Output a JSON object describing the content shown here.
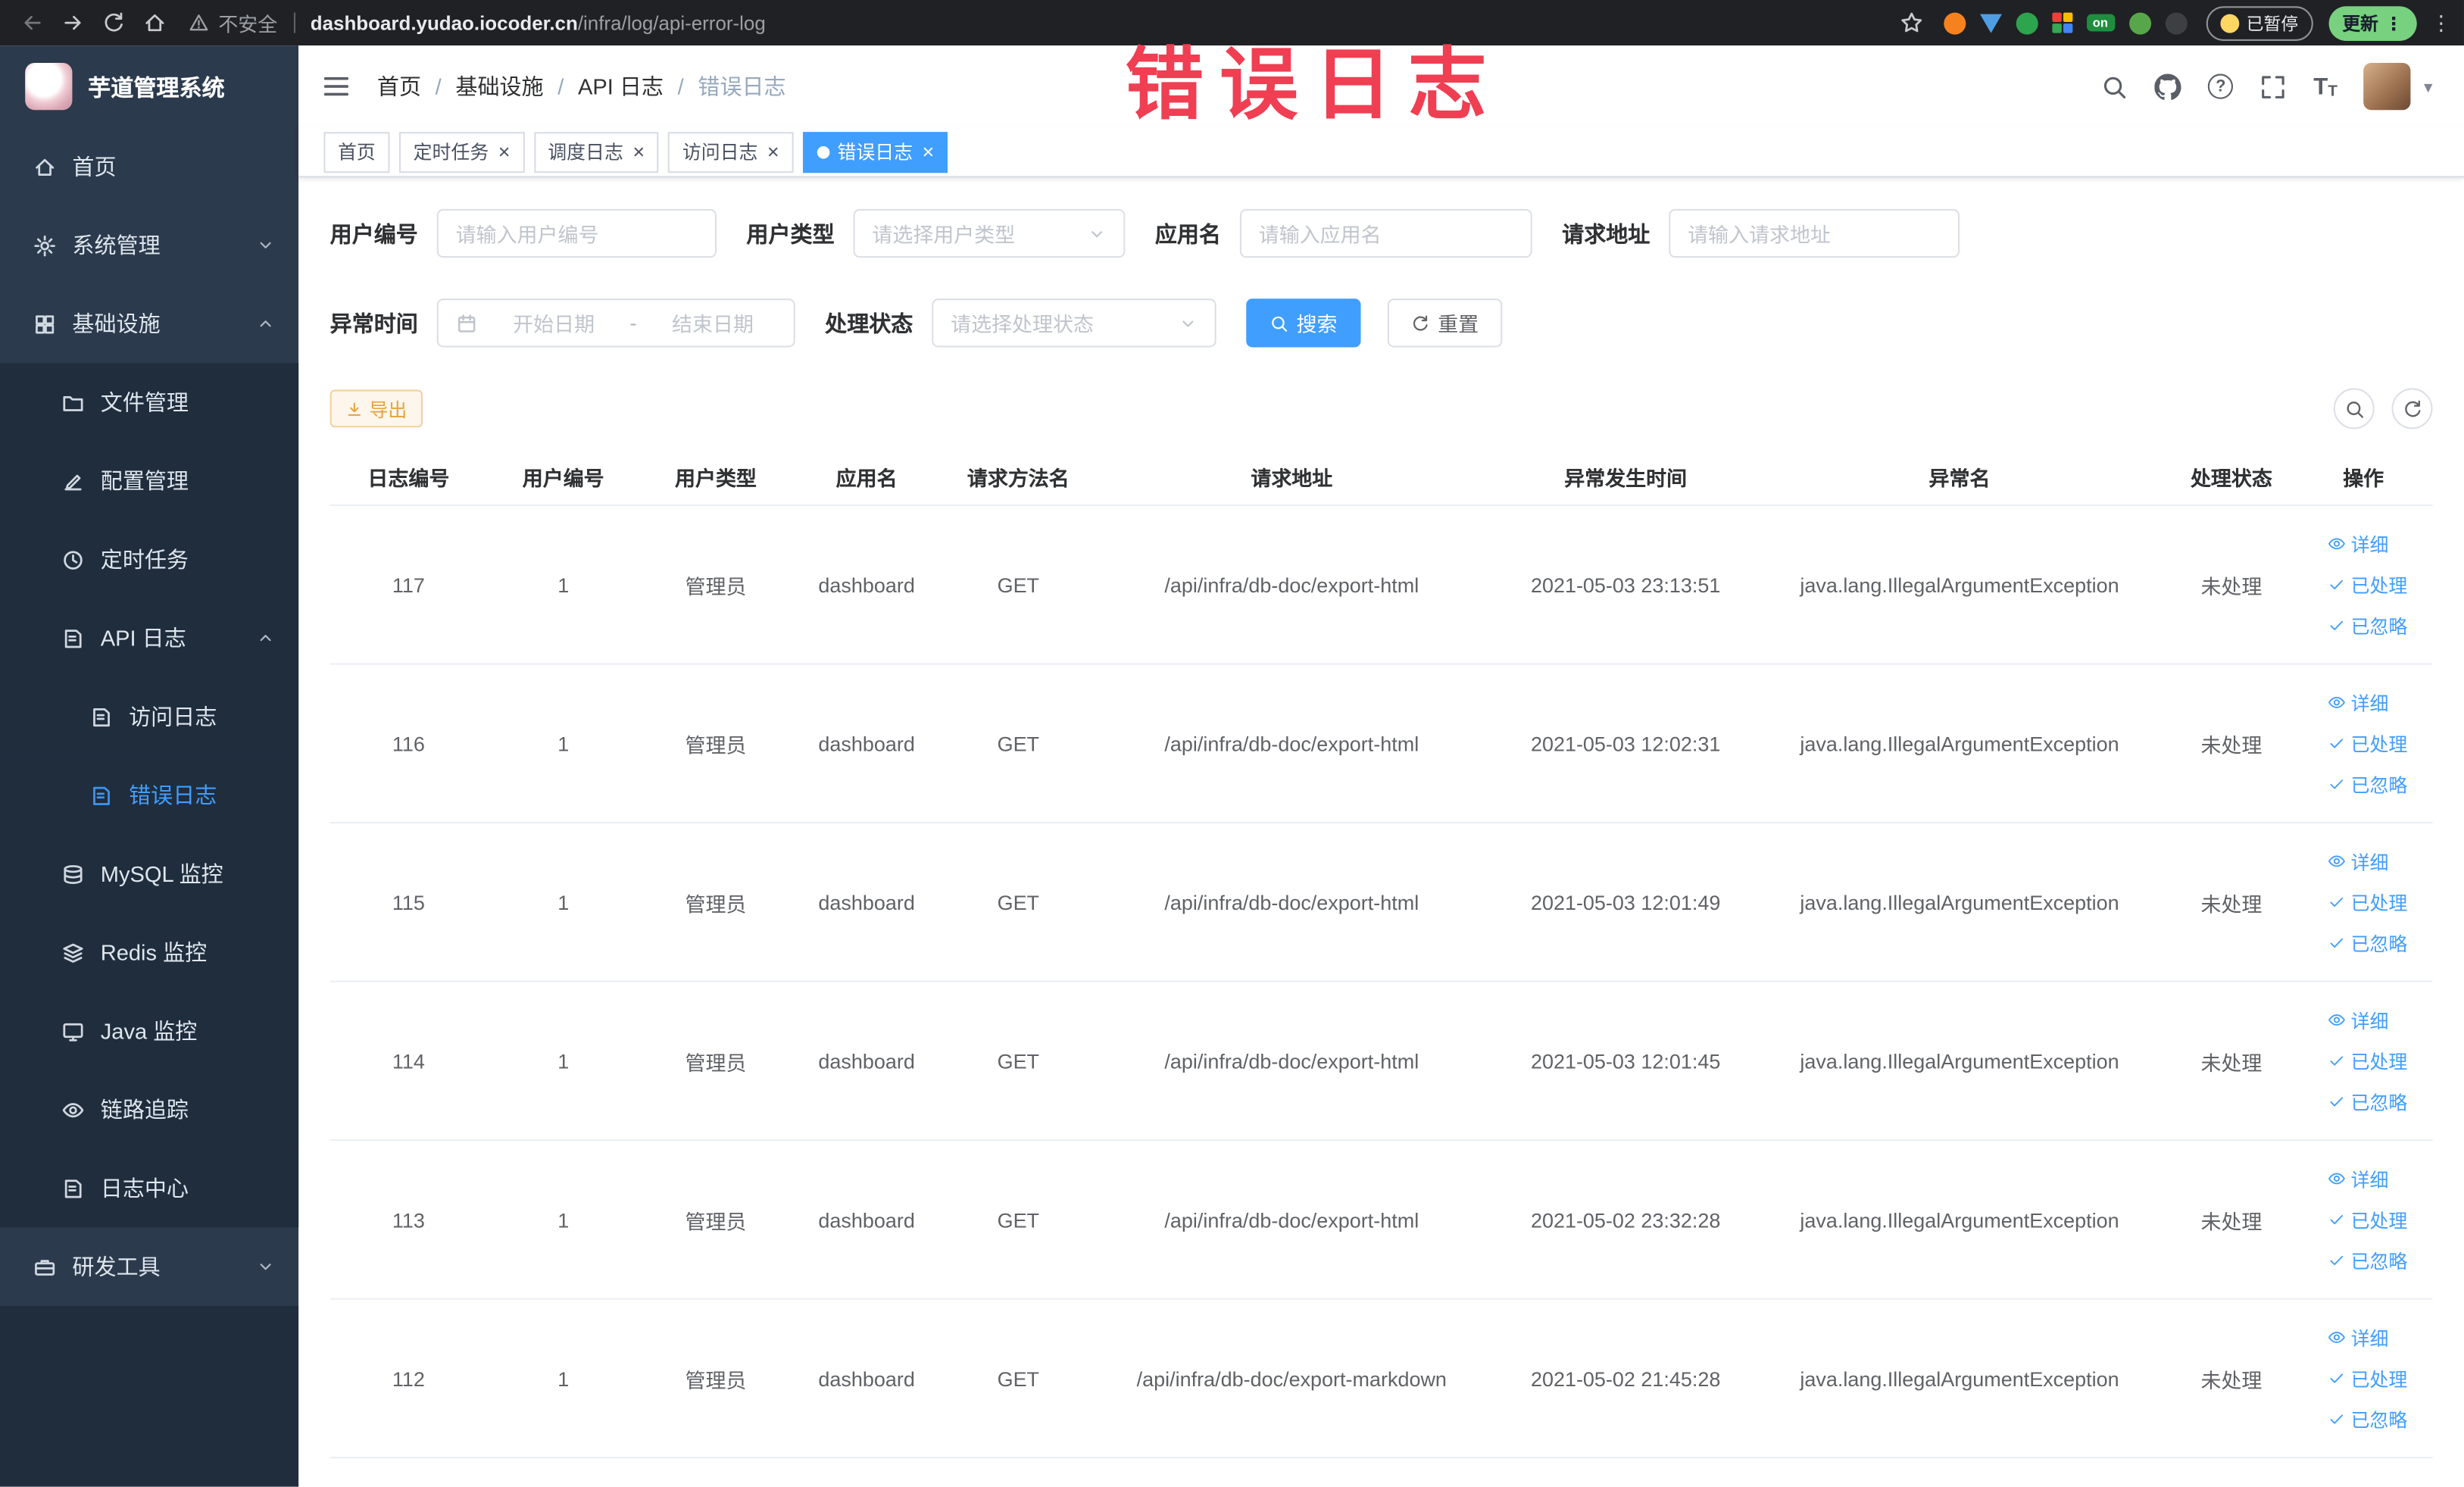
{
  "browser": {
    "security_label": "不安全",
    "url_domain": "dashboard.yudao.iocoder.cn",
    "url_path": "/infra/log/api-error-log",
    "paused_badge": "已暂停",
    "update_button": "更新"
  },
  "annotation": "错误日志",
  "sidebar": {
    "logo_title": "芋道管理系统",
    "items": [
      {
        "key": "home",
        "label": "首页",
        "icon": "home",
        "level": 1
      },
      {
        "key": "system",
        "label": "系统管理",
        "icon": "gear",
        "level": 1,
        "arrow": "down"
      },
      {
        "key": "infra",
        "label": "基础设施",
        "icon": "grid",
        "level": 1,
        "arrow": "up"
      },
      {
        "key": "file",
        "label": "文件管理",
        "icon": "folder",
        "level": 2
      },
      {
        "key": "config",
        "label": "配置管理",
        "icon": "edit",
        "level": 2
      },
      {
        "key": "job",
        "label": "定时任务",
        "icon": "clock",
        "level": 2
      },
      {
        "key": "api-log",
        "label": "API 日志",
        "icon": "doc",
        "level": 2,
        "arrow": "up"
      },
      {
        "key": "access-log",
        "label": "访问日志",
        "icon": "doc",
        "level": 3
      },
      {
        "key": "error-log",
        "label": "错误日志",
        "icon": "doc",
        "level": 3,
        "active": true
      },
      {
        "key": "mysql",
        "label": "MySQL 监控",
        "icon": "db",
        "level": 2
      },
      {
        "key": "redis",
        "label": "Redis 监控",
        "icon": "layers",
        "level": 2
      },
      {
        "key": "java",
        "label": "Java 监控",
        "icon": "monitor",
        "level": 2
      },
      {
        "key": "trace",
        "label": "链路追踪",
        "icon": "eye",
        "level": 2
      },
      {
        "key": "log-center",
        "label": "日志中心",
        "icon": "doc",
        "level": 2
      },
      {
        "key": "dev-tools",
        "label": "研发工具",
        "icon": "tools",
        "level": 1,
        "arrow": "down"
      }
    ]
  },
  "breadcrumb": [
    "首页",
    "基础设施",
    "API 日志",
    "错误日志"
  ],
  "tabs": [
    {
      "label": "首页",
      "closable": false,
      "active": false
    },
    {
      "label": "定时任务",
      "closable": true,
      "active": false
    },
    {
      "label": "调度日志",
      "closable": true,
      "active": false
    },
    {
      "label": "访问日志",
      "closable": true,
      "active": false
    },
    {
      "label": "错误日志",
      "closable": true,
      "active": true
    }
  ],
  "filters": {
    "user_id_label": "用户编号",
    "user_id_placeholder": "请输入用户编号",
    "user_type_label": "用户类型",
    "user_type_placeholder": "请选择用户类型",
    "app_name_label": "应用名",
    "app_name_placeholder": "请输入应用名",
    "request_url_label": "请求地址",
    "request_url_placeholder": "请输入请求地址",
    "exception_time_label": "异常时间",
    "date_start_placeholder": "开始日期",
    "date_end_placeholder": "结束日期",
    "process_status_label": "处理状态",
    "process_status_placeholder": "请选择处理状态",
    "search_button": "搜索",
    "reset_button": "重置"
  },
  "toolbar": {
    "export_button": "导出"
  },
  "table": {
    "columns": [
      "日志编号",
      "用户编号",
      "用户类型",
      "应用名",
      "请求方法名",
      "请求地址",
      "异常发生时间",
      "异常名",
      "处理状态",
      "操作"
    ],
    "actions": {
      "detail": "详细",
      "processed": "已处理",
      "ignored": "已忽略"
    },
    "rows": [
      {
        "id": "117",
        "user_id": "1",
        "user_type": "管理员",
        "app": "dashboard",
        "method": "GET",
        "url": "/api/infra/db-doc/export-html",
        "time": "2021-05-03 23:13:51",
        "exception": "java.lang.IllegalArgumentException",
        "status": "未处理"
      },
      {
        "id": "116",
        "user_id": "1",
        "user_type": "管理员",
        "app": "dashboard",
        "method": "GET",
        "url": "/api/infra/db-doc/export-html",
        "time": "2021-05-03 12:02:31",
        "exception": "java.lang.IllegalArgumentException",
        "status": "未处理"
      },
      {
        "id": "115",
        "user_id": "1",
        "user_type": "管理员",
        "app": "dashboard",
        "method": "GET",
        "url": "/api/infra/db-doc/export-html",
        "time": "2021-05-03 12:01:49",
        "exception": "java.lang.IllegalArgumentException",
        "status": "未处理"
      },
      {
        "id": "114",
        "user_id": "1",
        "user_type": "管理员",
        "app": "dashboard",
        "method": "GET",
        "url": "/api/infra/db-doc/export-html",
        "time": "2021-05-03 12:01:45",
        "exception": "java.lang.IllegalArgumentException",
        "status": "未处理"
      },
      {
        "id": "113",
        "user_id": "1",
        "user_type": "管理员",
        "app": "dashboard",
        "method": "GET",
        "url": "/api/infra/db-doc/export-html",
        "time": "2021-05-02 23:32:28",
        "exception": "java.lang.IllegalArgumentException",
        "status": "未处理"
      },
      {
        "id": "112",
        "user_id": "1",
        "user_type": "管理员",
        "app": "dashboard",
        "method": "GET",
        "url": "/api/infra/db-doc/export-markdown",
        "time": "2021-05-02 21:45:28",
        "exception": "java.lang.IllegalArgumentException",
        "status": "未处理"
      }
    ]
  },
  "ui": {
    "breadcrumb_sep": "/",
    "range_sep": "-",
    "close": "×",
    "more": "⋮",
    "caret": "▾",
    "question": "?",
    "font_icon_big": "T",
    "font_icon_small": "T",
    "ext_on": "on"
  },
  "colors": {
    "accent": "#409eff",
    "annotation": "#f03e52",
    "warning": "#e6a23c",
    "sidebar_bg": "#2b3a4c",
    "submenu_bg": "#1f2d3d"
  }
}
